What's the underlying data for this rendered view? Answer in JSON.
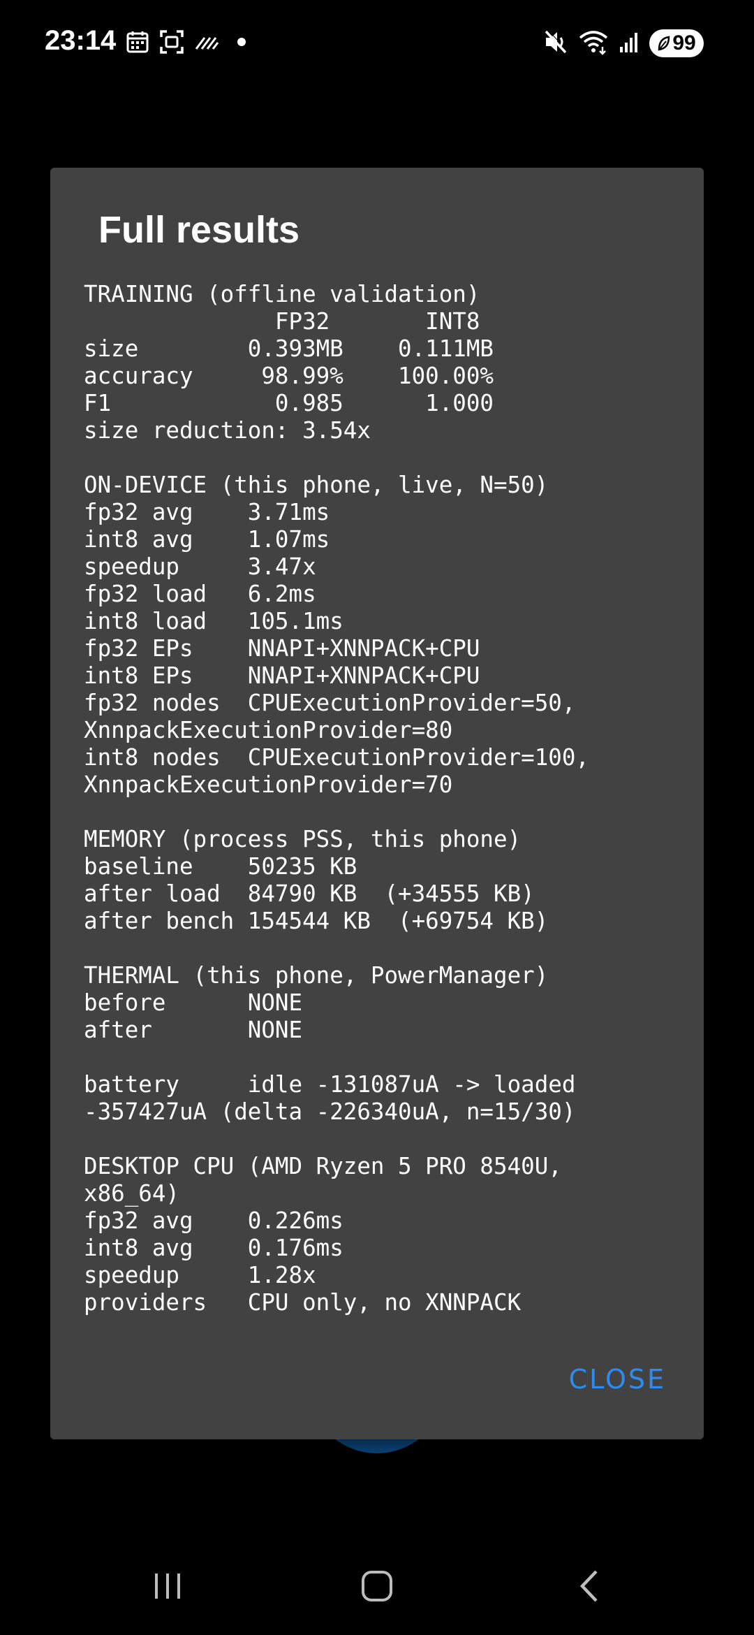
{
  "status_bar": {
    "time": "23:14",
    "battery_level": "99",
    "icons": [
      "calendar-icon",
      "screenshot-icon",
      "signal-scan-icon",
      "notification-dot-icon",
      "mute-icon",
      "wifi-icon",
      "cellular-signal-icon",
      "battery-icon"
    ]
  },
  "dialog": {
    "title": "Full results",
    "close_label": "CLOSE",
    "results": "TRAINING (offline validation)\n              FP32       INT8\nsize        0.393MB    0.111MB\naccuracy     98.99%    100.00%\nF1            0.985      1.000\nsize reduction: 3.54x\n\nON-DEVICE (this phone, live, N=50)\nfp32 avg    3.71ms\nint8 avg    1.07ms\nspeedup     3.47x\nfp32 load   6.2ms\nint8 load   105.1ms\nfp32 EPs    NNAPI+XNNPACK+CPU\nint8 EPs    NNAPI+XNNPACK+CPU\nfp32 nodes  CPUExecutionProvider=50,\nXnnpackExecutionProvider=80\nint8 nodes  CPUExecutionProvider=100,\nXnnpackExecutionProvider=70\n\nMEMORY (process PSS, this phone)\nbaseline    50235 KB\nafter load  84790 KB  (+34555 KB)\nafter bench 154544 KB  (+69754 KB)\n\nTHERMAL (this phone, PowerManager)\nbefore      NONE\nafter       NONE\n\nbattery     idle -131087uA -> loaded\n-357427uA (delta -226340uA, n=15/30)\n\nDESKTOP CPU (AMD Ryzen 5 PRO 8540U,\nx86_64)\nfp32 avg    0.226ms\nint8 avg    0.176ms\nspeedup     1.28x\nproviders   CPU only, no XNNPACK"
  },
  "nav_bar": {
    "buttons": [
      "recents-icon",
      "home-icon",
      "back-icon"
    ]
  },
  "colors": {
    "dialog_background": "#424242",
    "accent": "#2e8cf0",
    "screen_background": "#000000"
  }
}
